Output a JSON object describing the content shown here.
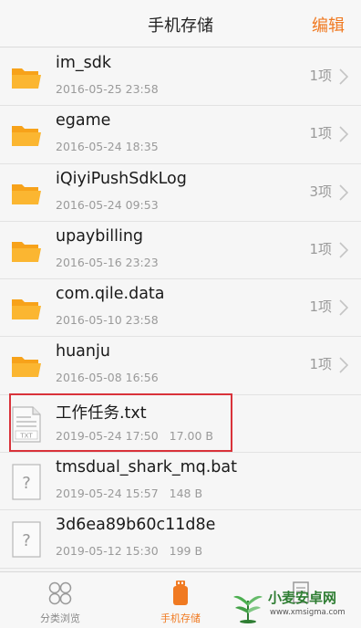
{
  "header": {
    "title": "手机存储",
    "edit_label": "编辑"
  },
  "colors": {
    "accent": "#f07a22",
    "folder": "#f7a21a",
    "highlight": "#d9323a"
  },
  "files": [
    {
      "name": "im_sdk",
      "date": "2016-05-25 23:58",
      "size": "",
      "count": "1项",
      "type": "folder-icon"
    },
    {
      "name": "egame",
      "date": "2016-05-24 18:35",
      "size": "",
      "count": "1项",
      "type": "folder-icon"
    },
    {
      "name": "iQiyiPushSdkLog",
      "date": "2016-05-24 09:53",
      "size": "",
      "count": "3项",
      "type": "folder-icon"
    },
    {
      "name": "upaybilling",
      "date": "2016-05-16 23:23",
      "size": "",
      "count": "1项",
      "type": "folder-icon"
    },
    {
      "name": "com.qile.data",
      "date": "2016-05-10 23:58",
      "size": "",
      "count": "1项",
      "type": "folder-icon"
    },
    {
      "name": "huanju",
      "date": "2016-05-08 16:56",
      "size": "",
      "count": "1项",
      "type": "folder-icon"
    },
    {
      "name": "工作任务.txt",
      "date": "2019-05-24 17:50",
      "size": "17.00 B",
      "count": "",
      "type": "txt-file-icon",
      "icon_label": "TXT"
    },
    {
      "name": "tmsdual_shark_mq.bat",
      "date": "2019-05-24 15:57",
      "size": "148 B",
      "count": "",
      "type": "unknown-file-icon",
      "icon_label": "?"
    },
    {
      "name": "3d6ea89b60c11d8e",
      "date": "2019-05-12 15:30",
      "size": "199 B",
      "count": "",
      "type": "unknown-file-icon",
      "icon_label": "?"
    }
  ],
  "tabs": [
    {
      "label": "分类浏览",
      "icon": "category-grid-icon",
      "active": false
    },
    {
      "label": "手机存储",
      "icon": "phone-storage-icon",
      "active": true
    },
    {
      "label": "",
      "icon": "document-icon",
      "active": false
    }
  ],
  "watermark": {
    "text": "小麦安卓网",
    "url": "www.xmsigma.com"
  }
}
